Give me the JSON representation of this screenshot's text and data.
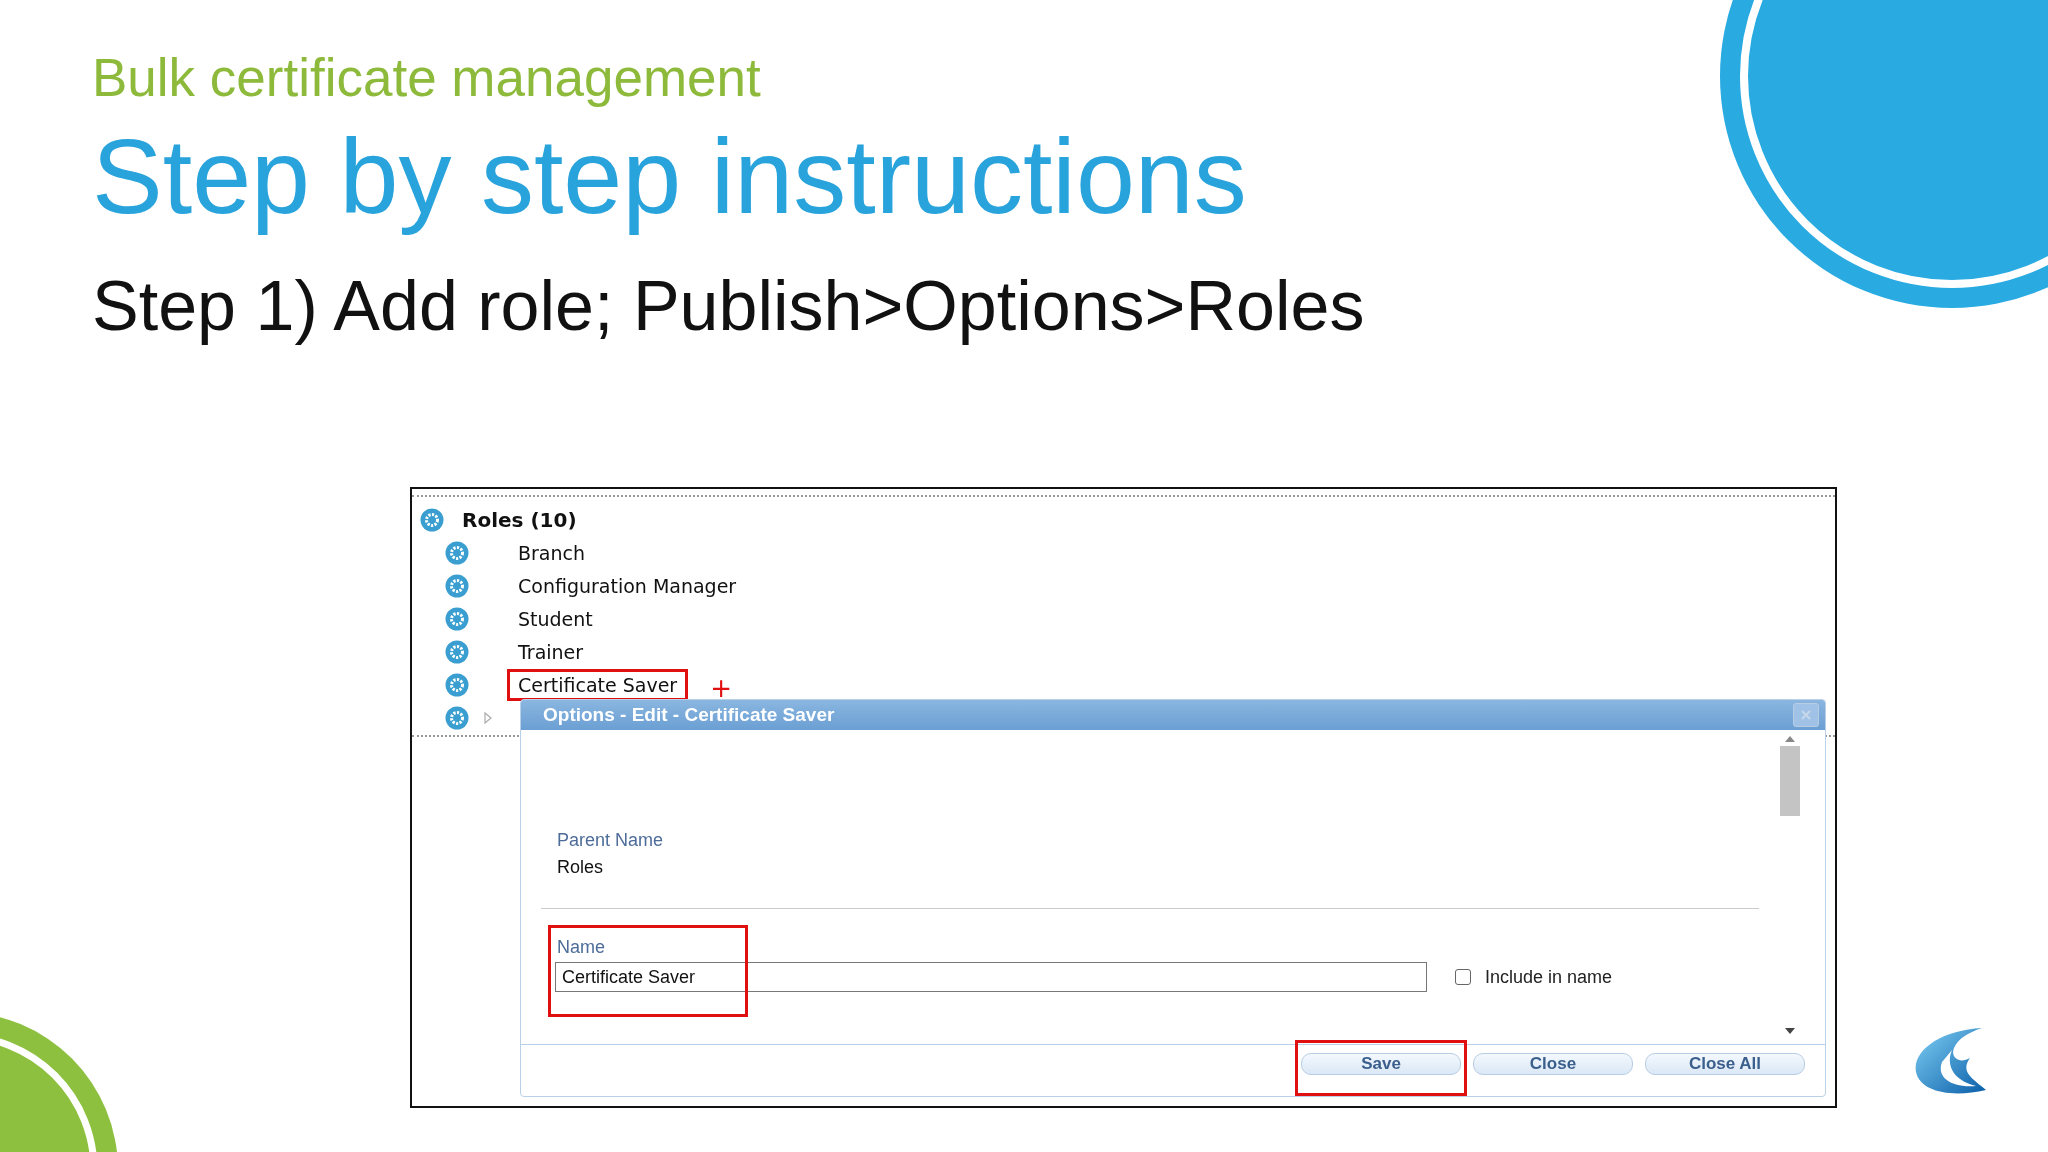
{
  "slide": {
    "subtitle": "Bulk certificate management",
    "title": "Step by step instructions",
    "step": "Step 1) Add role; Publish>Options>Roles"
  },
  "tree": {
    "root": "Roles (10)",
    "items": [
      {
        "kind": "leaf",
        "label": "Branch",
        "highlighted": false
      },
      {
        "kind": "leaf",
        "label": "Configuration Manager",
        "highlighted": false
      },
      {
        "kind": "leaf",
        "label": "Student",
        "highlighted": false
      },
      {
        "kind": "leaf",
        "label": "Trainer",
        "highlighted": false
      },
      {
        "kind": "leaf",
        "label": "Certificate Saver",
        "highlighted": true
      },
      {
        "kind": "branch",
        "expanded": false
      }
    ],
    "add_mark": "+"
  },
  "dialog": {
    "title": "Options - Edit - Certificate Saver",
    "parent_label": "Parent Name",
    "parent_value": "Roles",
    "name_label": "Name",
    "name_value": "Certificate Saver",
    "name_highlighted": true,
    "include_label": "Include in name",
    "include_checked": false,
    "buttons": [
      {
        "label": "Save",
        "highlighted": true
      },
      {
        "label": "Close",
        "highlighted": false
      },
      {
        "label": "Close All",
        "highlighted": false
      }
    ]
  }
}
